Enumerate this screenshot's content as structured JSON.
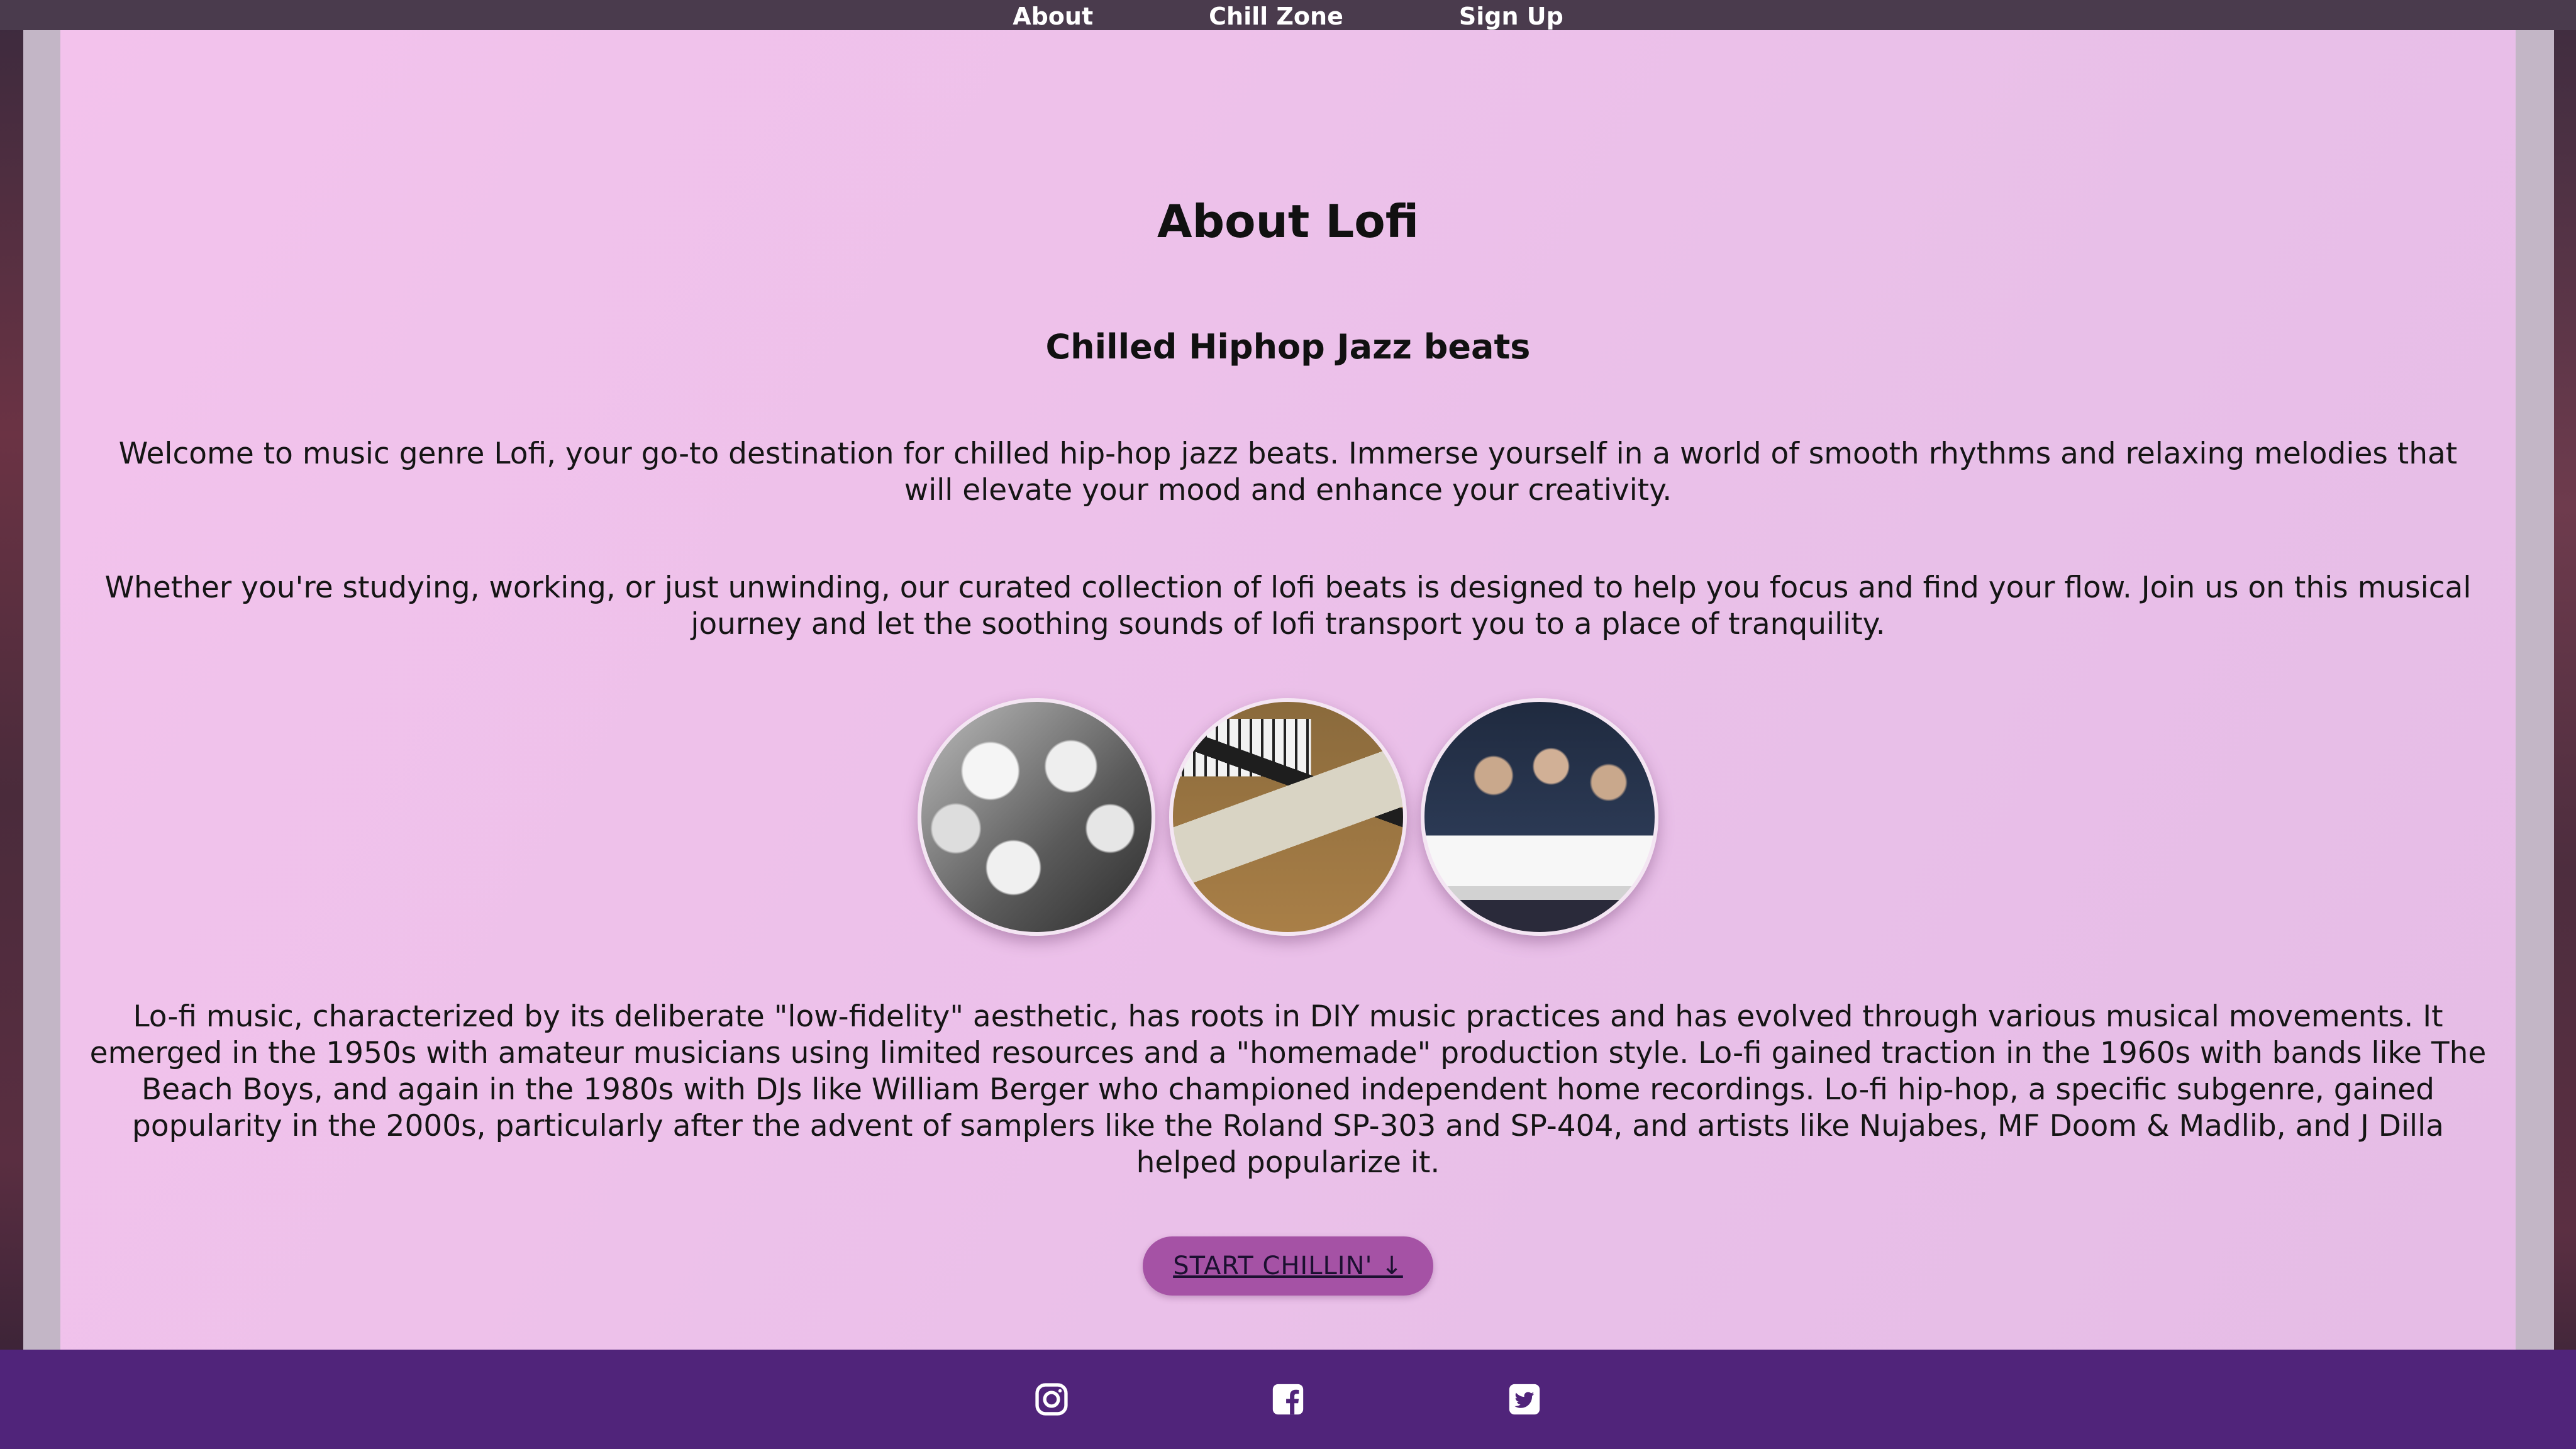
{
  "nav": {
    "items": [
      "About",
      "Chill Zone",
      "Sign Up"
    ]
  },
  "main": {
    "title": "About Lofi",
    "subtitle": "Chilled Hiphop Jazz beats",
    "paragraph1": "Welcome to music genre Lofi, your go-to destination for chilled hip-hop jazz beats. Immerse yourself in a world of smooth rhythms and relaxing melodies that will elevate your mood and enhance your creativity.",
    "paragraph2": "Whether you're studying, working, or just unwinding, our curated collection of lofi beats is designed to help you focus and find your flow. Join us on this musical journey and let the soothing sounds of lofi transport you to a place of tranquility.",
    "paragraph3": "Lo-fi music, characterized by its deliberate \"low-fidelity\" aesthetic, has roots in DIY music practices and has evolved through various musical movements. It emerged in the 1950s with amateur musicians using limited resources and a \"homemade\" production style. Lo-fi gained traction in the 1960s with bands like The Beach Boys, and again in the 1980s with DJs like William Berger who championed independent home recordings. Lo-fi hip-hop, a specific subgenre, gained popularity in the 2000s, particularly after the advent of samplers like the Roland SP-303 and SP-404, and artists like Nujabes, MF Doom & Madlib, and J Dilla helped popularize it.",
    "cta_label": "START CHILLIN' ↓"
  },
  "footer": {
    "icons": [
      "instagram-icon",
      "facebook-icon",
      "twitter-icon"
    ]
  },
  "colors": {
    "nav_bg": "#4a3b4d",
    "panel_bg": "#eec1eb",
    "cta_bg": "#a552a5",
    "footer_bg": "#50247a"
  }
}
